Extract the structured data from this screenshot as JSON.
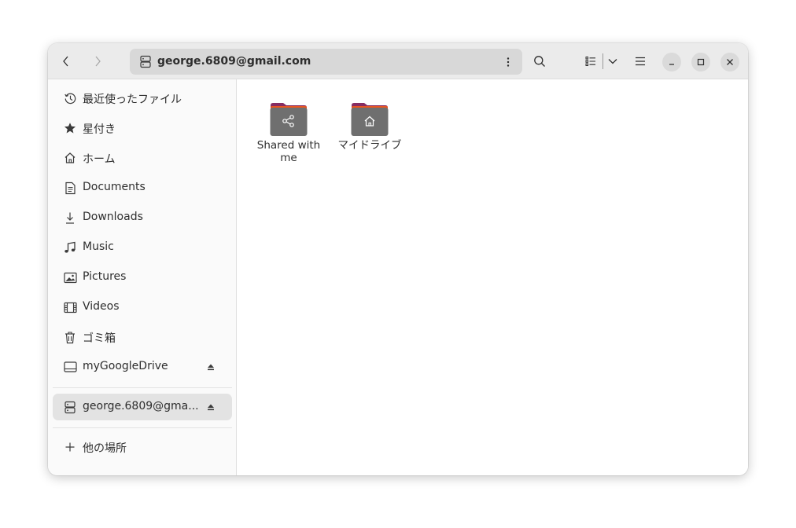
{
  "header": {
    "back_icon": "chevron-left-icon",
    "forward_icon": "chevron-right-icon",
    "location_icon": "server-icon",
    "location": "george.6809@gmail.com",
    "location_menu_icon": "vertical-dots-icon",
    "search_icon": "search-icon",
    "view_icon": "list-view-icon",
    "view_dropdown_icon": "chevron-down-icon",
    "menu_icon": "hamburger-menu-icon",
    "window_controls": [
      "minimize-icon",
      "maximize-icon",
      "close-icon"
    ]
  },
  "sidebar": {
    "items": [
      {
        "label": "最近使ったファイル",
        "icon": "recent-icon"
      },
      {
        "label": "星付き",
        "icon": "star-icon"
      },
      {
        "label": "ホーム",
        "icon": "home-icon"
      },
      {
        "label": "Documents",
        "icon": "document-icon"
      },
      {
        "label": "Downloads",
        "icon": "download-icon"
      },
      {
        "label": "Music",
        "icon": "music-icon"
      },
      {
        "label": "Pictures",
        "icon": "picture-icon"
      },
      {
        "label": "Videos",
        "icon": "video-icon"
      },
      {
        "label": "ゴミ箱",
        "icon": "trash-icon"
      },
      {
        "label": "myGoogleDrive",
        "icon": "drive-icon",
        "eject": true
      }
    ],
    "mounted": {
      "label": "george.6809@gma...",
      "icon": "server-icon",
      "eject": true,
      "selected": true
    },
    "other_locations": {
      "label": "他の場所",
      "icon": "plus-icon"
    }
  },
  "content": {
    "items": [
      {
        "name": "Shared with me",
        "icon": "shared-folder-icon"
      },
      {
        "name": "マイドライブ",
        "icon": "home-folder-icon"
      }
    ]
  },
  "colors": {
    "folder_top": "#E95420",
    "folder_tab": "#872D62",
    "folder_body": "#6F6F6F",
    "headerbar": "#EBEBEB",
    "sidebar": "#FAFAFA",
    "selected": "#E3E3E3"
  }
}
